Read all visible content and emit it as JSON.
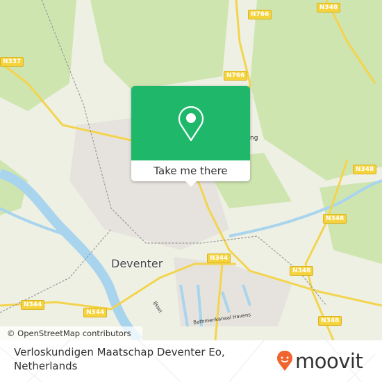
{
  "map": {
    "road_labels": [
      "N766",
      "N348",
      "N337",
      "N766",
      "N348",
      "N348",
      "N348",
      "N348",
      "N344",
      "N344",
      "N344"
    ],
    "city_label": "Deventer",
    "river_label": "IJssel",
    "canal_label": "Bathmenkanaal Havens",
    "partial_label": "ng",
    "attribution": "© OpenStreetMap contributors"
  },
  "popup": {
    "icon": "map-pin-icon",
    "button_label": "Take me there",
    "color": "#1fb86b"
  },
  "footer": {
    "place_line1": "Verloskundigen Maatschap Deventer Eo,",
    "place_line2": "Netherlands",
    "logo_text": "moovit",
    "logo_color": "#f0642d"
  }
}
